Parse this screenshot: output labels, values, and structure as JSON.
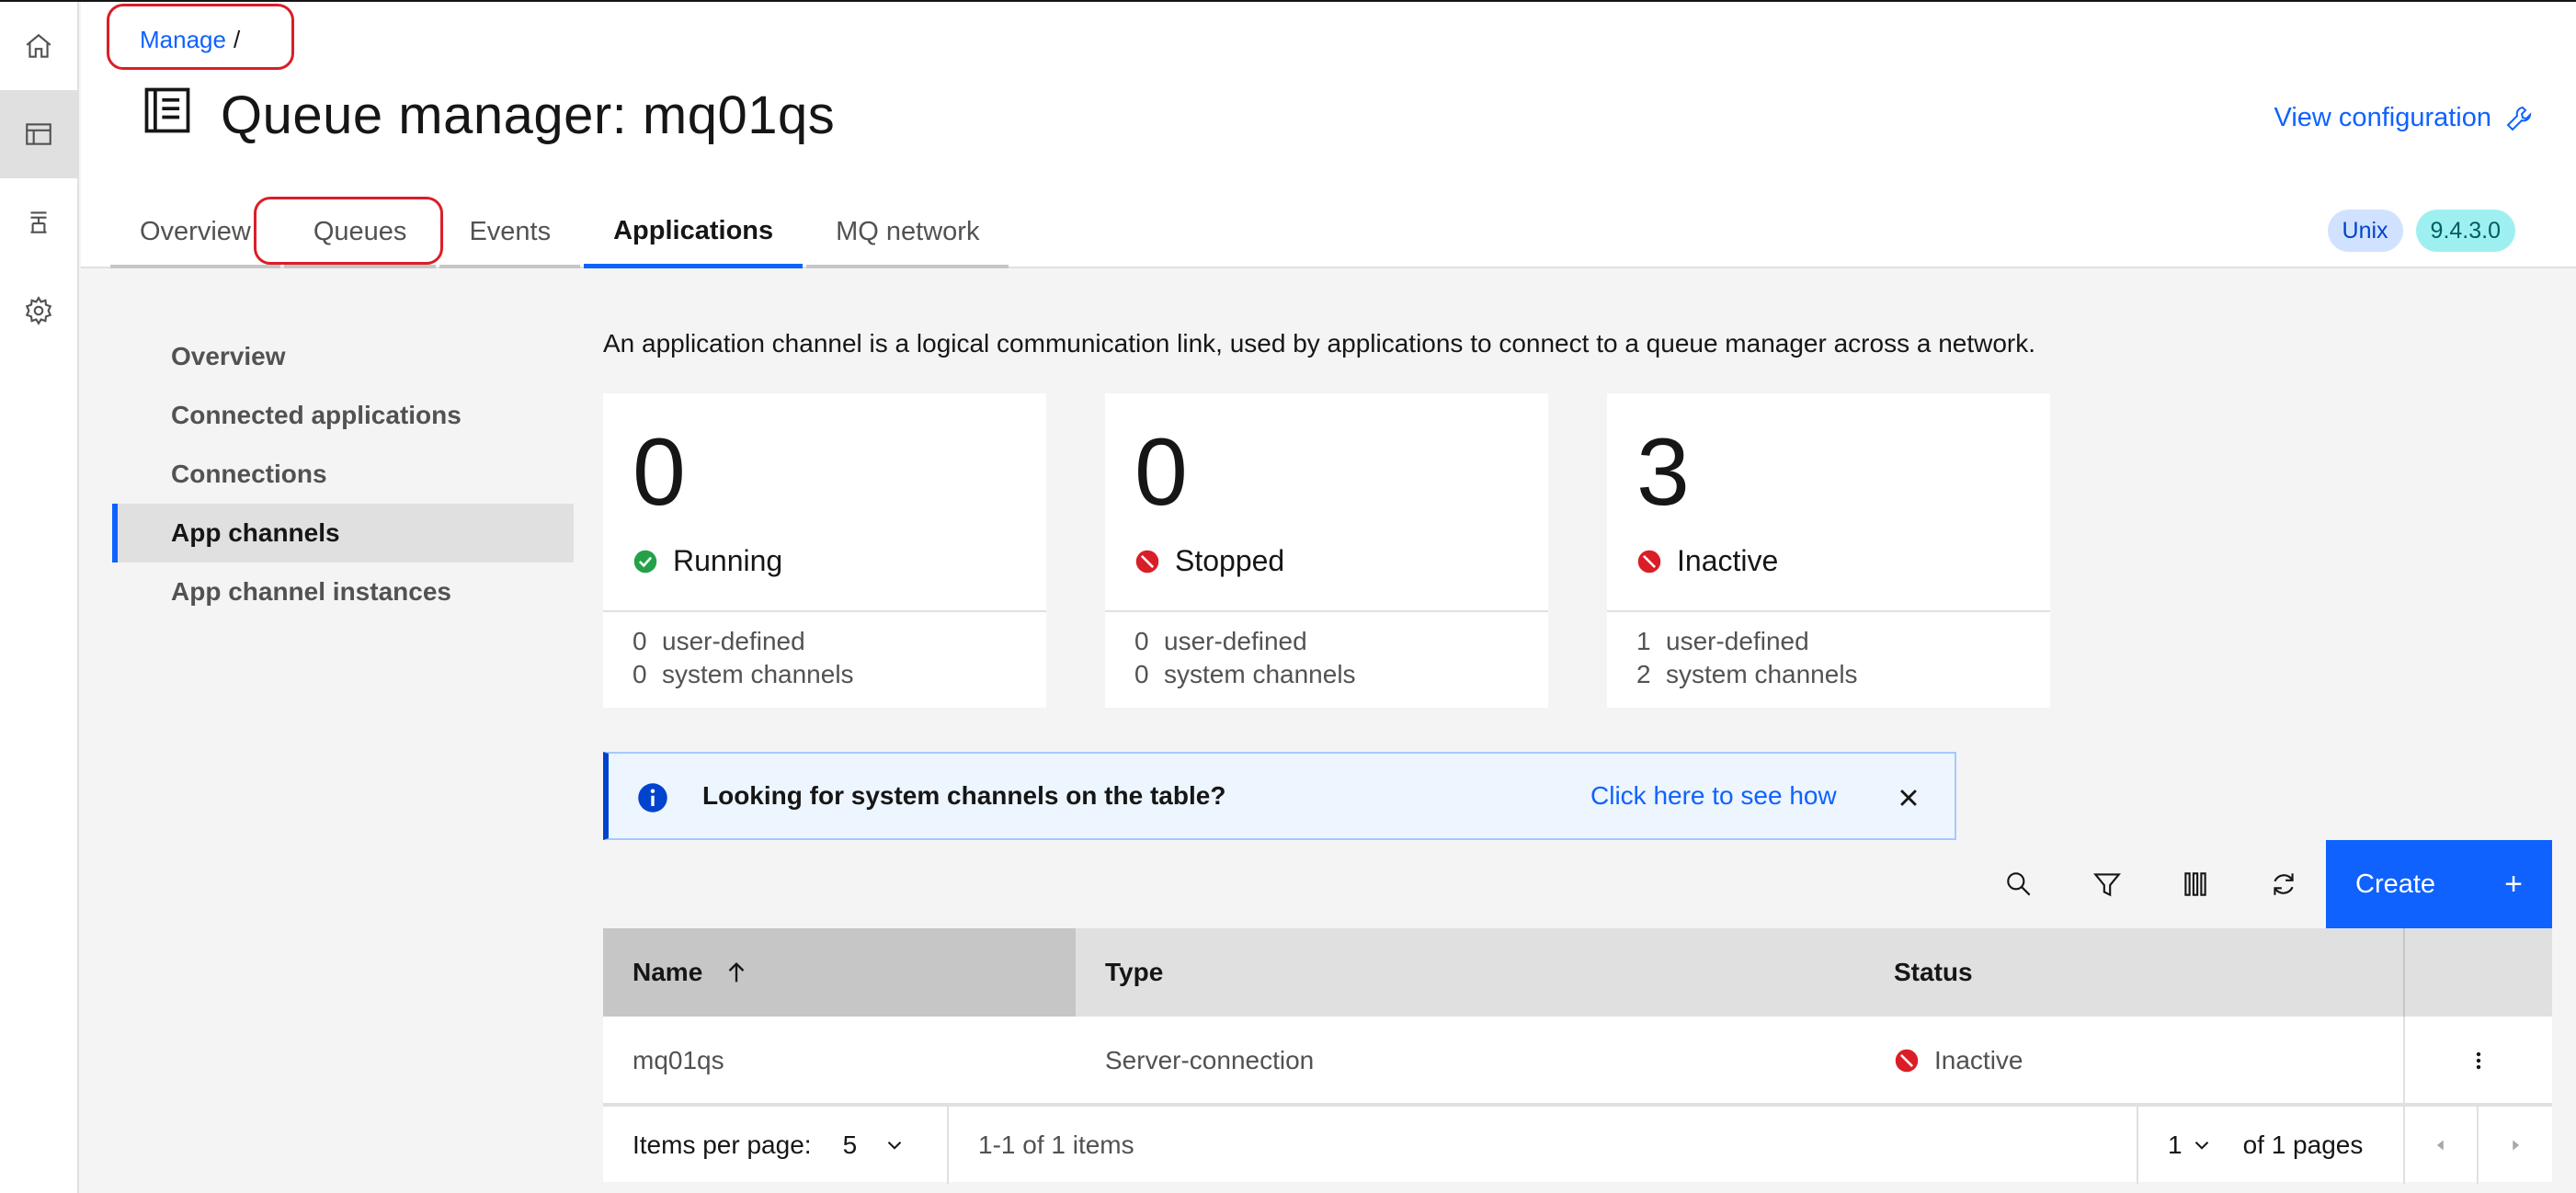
{
  "breadcrumb": {
    "root": "Manage",
    "separator": "/"
  },
  "page": {
    "title": "Queue manager: mq01qs",
    "view_configuration": "View configuration"
  },
  "tabs": [
    {
      "label": "Overview",
      "active": false
    },
    {
      "label": "Queues",
      "active": false
    },
    {
      "label": "Events",
      "active": false
    },
    {
      "label": "Applications",
      "active": true
    },
    {
      "label": "MQ network",
      "active": false
    }
  ],
  "tags": {
    "platform": "Unix",
    "version": "9.4.3.0"
  },
  "rail_icons": [
    "home-icon",
    "dashboard-icon",
    "hierarchy-icon",
    "settings-icon"
  ],
  "sidenav": [
    {
      "label": "Overview",
      "active": false
    },
    {
      "label": "Connected applications",
      "active": false
    },
    {
      "label": "Connections",
      "active": false
    },
    {
      "label": "App channels",
      "active": true
    },
    {
      "label": "App channel instances",
      "active": false
    }
  ],
  "description": "An application channel is a logical communication link, used by applications to connect to a queue manager across a network.",
  "cards": [
    {
      "count": "0",
      "status": "Running",
      "status_color": "#24a148",
      "user_defined": "0",
      "user_defined_label": "user-defined",
      "system": "0",
      "system_label": "system channels"
    },
    {
      "count": "0",
      "status": "Stopped",
      "status_color": "#da1e28",
      "user_defined": "0",
      "user_defined_label": "user-defined",
      "system": "0",
      "system_label": "system channels"
    },
    {
      "count": "3",
      "status": "Inactive",
      "status_color": "#da1e28",
      "user_defined": "1",
      "user_defined_label": "user-defined",
      "system": "2",
      "system_label": "system channels"
    }
  ],
  "notification": {
    "title": "Looking for system channels on the table?",
    "link": "Click here to see how"
  },
  "toolbar": {
    "create_label": "Create",
    "create_plus": "+"
  },
  "table": {
    "columns": [
      "Name",
      "Type",
      "Status"
    ],
    "rows": [
      {
        "name": "mq01qs",
        "type": "Server-connection",
        "status": "Inactive"
      }
    ]
  },
  "pagination": {
    "items_per_page_label": "Items per page:",
    "items_per_page": "5",
    "range": "1-1 of 1 items",
    "page": "1",
    "of_pages": "of 1 pages"
  },
  "colors": {
    "accent": "#0f62fe",
    "error": "#da1e28",
    "success": "#24a148"
  }
}
